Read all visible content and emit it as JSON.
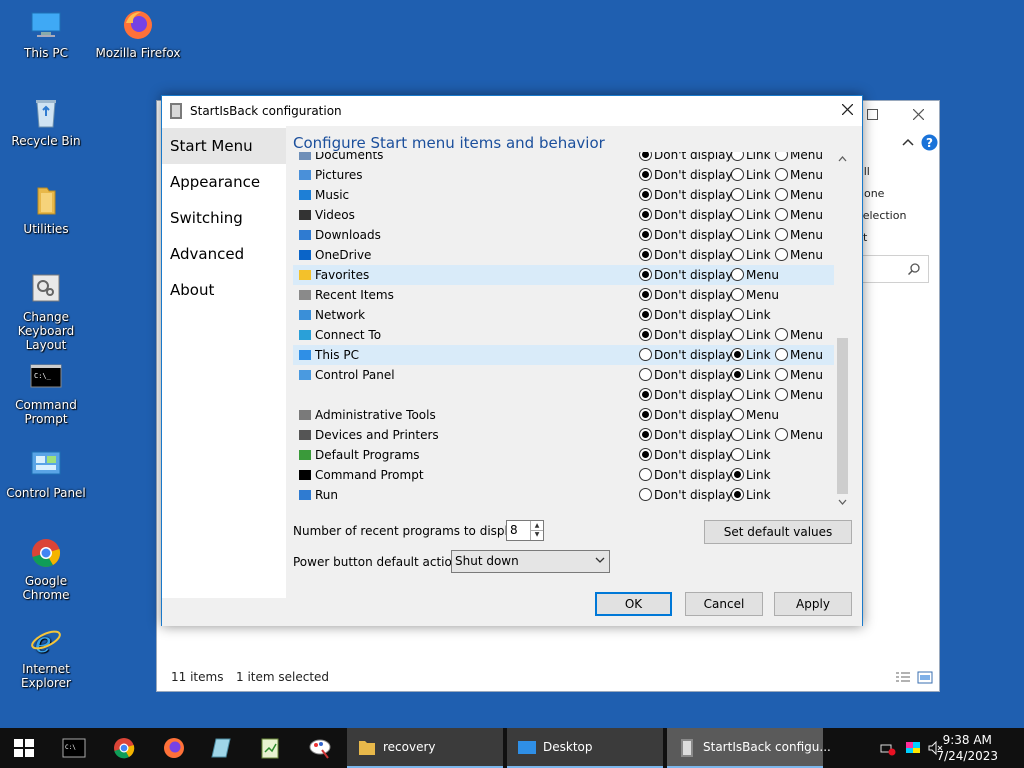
{
  "desktop": {
    "icons": [
      {
        "label": "This PC"
      },
      {
        "label": "Mozilla Firefox"
      },
      {
        "label": "Recycle Bin"
      },
      {
        "label": "Utilities"
      },
      {
        "label": "Change Keyboard Layout"
      },
      {
        "label": "Command Prompt"
      },
      {
        "label": "Control Panel"
      },
      {
        "label": "Google Chrome"
      },
      {
        "label": "Internet Explorer"
      }
    ]
  },
  "explorer": {
    "ribbon": [
      "all",
      "none",
      "selection",
      "ct"
    ],
    "status_items": "11 items",
    "status_selected": "1 item selected"
  },
  "dialog": {
    "title": "StartIsBack configuration",
    "nav": [
      "Start Menu",
      "Appearance",
      "Switching",
      "Advanced",
      "About"
    ],
    "heading": "Configure Start menu items and behavior",
    "options": {
      "dont": "Don't display",
      "link": "Link",
      "menu": "Menu"
    },
    "rows": [
      {
        "label": "Documents",
        "icon": "documents-icon",
        "sel": "dont",
        "opts": [
          "dont",
          "link",
          "menu"
        ]
      },
      {
        "label": "Pictures",
        "icon": "pictures-icon",
        "sel": "dont",
        "opts": [
          "dont",
          "link",
          "menu"
        ]
      },
      {
        "label": "Music",
        "icon": "music-icon",
        "sel": "dont",
        "opts": [
          "dont",
          "link",
          "menu"
        ]
      },
      {
        "label": "Videos",
        "icon": "videos-icon",
        "sel": "dont",
        "opts": [
          "dont",
          "link",
          "menu"
        ]
      },
      {
        "label": "Downloads",
        "icon": "downloads-icon",
        "sel": "dont",
        "opts": [
          "dont",
          "link",
          "menu"
        ]
      },
      {
        "label": "OneDrive",
        "icon": "onedrive-icon",
        "sel": "dont",
        "opts": [
          "dont",
          "link",
          "menu"
        ]
      },
      {
        "label": "Favorites",
        "icon": "favorites-icon",
        "sel": "dont",
        "opts": [
          "dont",
          "menu"
        ],
        "highlight": true
      },
      {
        "label": "Recent Items",
        "icon": "recent-items-icon",
        "sel": "dont",
        "opts": [
          "dont",
          "menu"
        ]
      },
      {
        "label": "Network",
        "icon": "network-icon",
        "sel": "dont",
        "opts": [
          "dont",
          "link"
        ]
      },
      {
        "label": "Connect To",
        "icon": "connect-to-icon",
        "sel": "dont",
        "opts": [
          "dont",
          "link",
          "menu"
        ]
      },
      {
        "label": "This PC",
        "icon": "this-pc-icon",
        "sel": "link",
        "opts": [
          "dont",
          "link",
          "menu"
        ],
        "highlight": true
      },
      {
        "label": "Control Panel",
        "icon": "control-panel-icon",
        "sel": "link",
        "opts": [
          "dont",
          "link",
          "menu"
        ]
      },
      {
        "label": "",
        "icon": "",
        "sel": "dont",
        "opts": [
          "dont",
          "link",
          "menu"
        ]
      },
      {
        "label": "Administrative Tools",
        "icon": "admin-tools-icon",
        "sel": "dont",
        "opts": [
          "dont",
          "menu"
        ]
      },
      {
        "label": "Devices and Printers",
        "icon": "devices-printers-icon",
        "sel": "dont",
        "opts": [
          "dont",
          "link",
          "menu"
        ]
      },
      {
        "label": "Default Programs",
        "icon": "default-programs-icon",
        "sel": "dont",
        "opts": [
          "dont",
          "link"
        ]
      },
      {
        "label": "Command Prompt",
        "icon": "command-prompt-icon",
        "sel": "link",
        "opts": [
          "dont",
          "link"
        ]
      },
      {
        "label": "Run",
        "icon": "run-icon",
        "sel": "link",
        "opts": [
          "dont",
          "link"
        ]
      }
    ],
    "recent_label": "Number of recent programs to display:",
    "recent_value": "8",
    "set_default": "Set default values",
    "power_label": "Power button default action:",
    "power_value": "Shut down",
    "ok": "OK",
    "cancel": "Cancel",
    "apply": "Apply"
  },
  "taskbar": {
    "tasks": [
      "recovery",
      "Desktop",
      "StartIsBack configu..."
    ],
    "time": "9:38 AM",
    "date": "7/24/2023"
  },
  "colors": {
    "desktop": "#1f5fb0",
    "heading": "#1b4f9c",
    "accent": "#0078d7",
    "taskbar": "#101010"
  }
}
